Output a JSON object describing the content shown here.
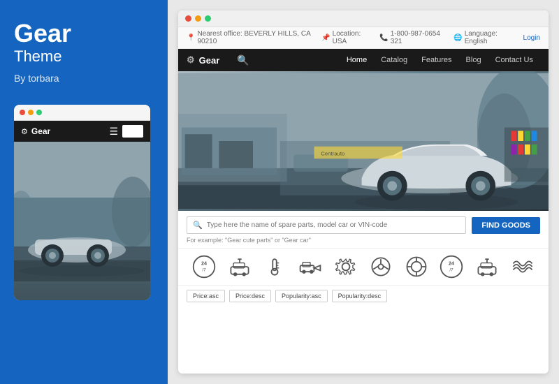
{
  "left": {
    "title": "Gear",
    "subtitle": "Theme",
    "author": "By torbara"
  },
  "browser": {
    "topbar": {
      "office": "Nearest office: BEVERLY HILLS, CA 90210",
      "location": "Location: USA",
      "phone": "1-800-987-0654 321",
      "language": "Language: English",
      "login": "Login"
    },
    "navbar": {
      "logo": "Gear",
      "links": [
        "Home",
        "Catalog",
        "Features",
        "Blog",
        "Contact Us"
      ]
    },
    "search": {
      "placeholder": "Type here the name of spare parts, model car or VIN-code",
      "button": "FIND GOODS",
      "example": "For example: \"Gear cute parts\" or \"Gear car\""
    },
    "filters": [
      "Price:asc",
      "Price:desc",
      "Popularity:asc",
      "Popularity:desc"
    ]
  },
  "icons": {
    "services": [
      "clock-24-7",
      "plug-car",
      "temperature-gauge",
      "car-tow",
      "gear-settings",
      "steering-wheel",
      "tire-wheel",
      "clock-24-7-2",
      "plug-car-2",
      "wave-liquid"
    ]
  }
}
